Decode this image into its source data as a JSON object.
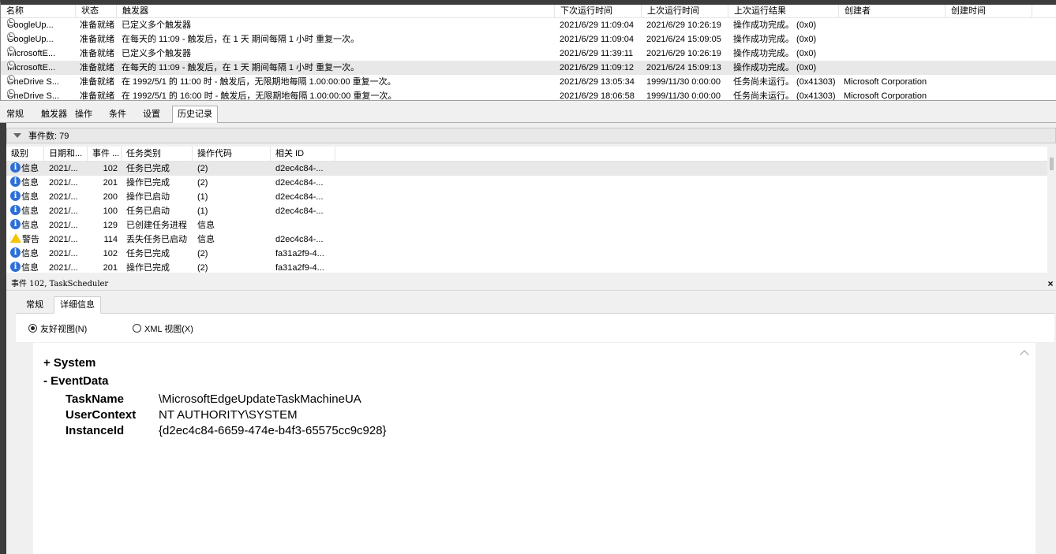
{
  "task_list": {
    "columns": [
      "名称",
      "状态",
      "触发器",
      "下次运行时间",
      "上次运行时间",
      "上次运行结果",
      "创建者",
      "创建时间"
    ],
    "rows": [
      {
        "name": "GoogleUp...",
        "status": "准备就绪",
        "trigger": "已定义多个触发器",
        "next_run": "2021/6/29 11:09:04",
        "last_run": "2021/6/29 10:26:19",
        "result": "操作成功完成。 (0x0)",
        "author": ""
      },
      {
        "name": "GoogleUp...",
        "status": "准备就绪",
        "trigger": "在每天的 11:09 - 触发后，在 1 天 期间每隔 1 小时 重复一次。",
        "next_run": "2021/6/29 11:09:04",
        "last_run": "2021/6/24 15:09:05",
        "result": "操作成功完成。 (0x0)",
        "author": ""
      },
      {
        "name": "MicrosoftE...",
        "status": "准备就绪",
        "trigger": "已定义多个触发器",
        "next_run": "2021/6/29 11:39:11",
        "last_run": "2021/6/29 10:26:19",
        "result": "操作成功完成。 (0x0)",
        "author": ""
      },
      {
        "name": "MicrosoftE...",
        "status": "准备就绪",
        "trigger": "在每天的 11:09 - 触发后，在 1 天 期间每隔 1 小时 重复一次。",
        "next_run": "2021/6/29 11:09:12",
        "last_run": "2021/6/24 15:09:13",
        "result": "操作成功完成。 (0x0)",
        "author": "",
        "selected": true
      },
      {
        "name": "OneDrive S...",
        "status": "准备就绪",
        "trigger": "在 1992/5/1 的 11:00 时 - 触发后，无限期地每隔 1.00:00:00 重复一次。",
        "next_run": "2021/6/29 13:05:34",
        "last_run": "1999/11/30 0:00:00",
        "result": "任务尚未运行。 (0x41303)",
        "author": "Microsoft Corporation"
      },
      {
        "name": "OneDrive S...",
        "status": "准备就绪",
        "trigger": "在 1992/5/1 的 16:00 时 - 触发后，无限期地每隔 1.00:00:00 重复一次。",
        "next_run": "2021/6/29 18:06:58",
        "last_run": "1999/11/30 0:00:00",
        "result": "任务尚未运行。 (0x41303)",
        "author": "Microsoft Corporation"
      }
    ]
  },
  "tabs": [
    "常规",
    "触发器",
    "操作",
    "条件",
    "设置",
    "历史记录"
  ],
  "active_tab": "历史记录",
  "history": {
    "filter_label": "事件数: 79",
    "columns": [
      "级别",
      "日期和...",
      "事件 ...",
      "任务类别",
      "操作代码",
      "相关 ID"
    ],
    "rows": [
      {
        "icon": "info-icon",
        "level": "信息",
        "date": "2021/...",
        "event_id": "102",
        "category": "任务已完成",
        "opcode": "(2)",
        "correlation": "d2ec4c84-...",
        "selected": true
      },
      {
        "icon": "info-icon",
        "level": "信息",
        "date": "2021/...",
        "event_id": "201",
        "category": "操作已完成",
        "opcode": "(2)",
        "correlation": "d2ec4c84-..."
      },
      {
        "icon": "info-icon",
        "level": "信息",
        "date": "2021/...",
        "event_id": "200",
        "category": "操作已启动",
        "opcode": "(1)",
        "correlation": "d2ec4c84-..."
      },
      {
        "icon": "info-icon",
        "level": "信息",
        "date": "2021/...",
        "event_id": "100",
        "category": "任务已启动",
        "opcode": "(1)",
        "correlation": "d2ec4c84-..."
      },
      {
        "icon": "info-icon",
        "level": "信息",
        "date": "2021/...",
        "event_id": "129",
        "category": "已创建任务进程",
        "opcode": "信息",
        "correlation": ""
      },
      {
        "icon": "warning-icon",
        "level": "警告",
        "date": "2021/...",
        "event_id": "114",
        "category": "丢失任务已启动",
        "opcode": "信息",
        "correlation": "d2ec4c84-..."
      },
      {
        "icon": "info-icon",
        "level": "信息",
        "date": "2021/...",
        "event_id": "102",
        "category": "任务已完成",
        "opcode": "(2)",
        "correlation": "fa31a2f9-4..."
      },
      {
        "icon": "info-icon",
        "level": "信息",
        "date": "2021/...",
        "event_id": "201",
        "category": "操作已完成",
        "opcode": "(2)",
        "correlation": "fa31a2f9-4..."
      }
    ]
  },
  "details": {
    "title": "事件 102, TaskScheduler",
    "close_label": "×",
    "tabs": [
      "常规",
      "详细信息"
    ],
    "active_tab": "详细信息",
    "radio_friendly": "友好视图(N)",
    "radio_xml": "XML 视图(X)",
    "system_node": "+ System",
    "eventdata_node": "- EventData",
    "fields": [
      {
        "key": "TaskName",
        "value": "\\MicrosoftEdgeUpdateTaskMachineUA"
      },
      {
        "key": "UserContext",
        "value": "NT AUTHORITY\\SYSTEM"
      },
      {
        "key": "InstanceId",
        "value": "{d2ec4c84-6659-474e-b4f3-65575cc9c928}"
      }
    ]
  }
}
